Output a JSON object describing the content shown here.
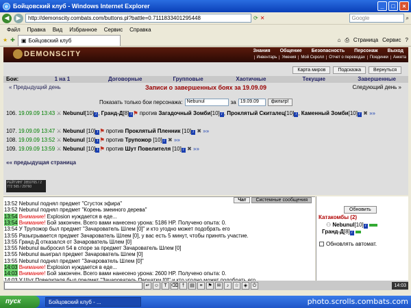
{
  "window": {
    "title": "Бойцовский клуб - Windows Internet Explorer"
  },
  "address": {
    "url": "http://demonscity.combats.com/buttons.pl?battle=0.7111833401295448",
    "search_placeholder": "Google"
  },
  "menu": [
    "Файл",
    "Правка",
    "Вид",
    "Избранное",
    "Сервис",
    "Справка"
  ],
  "tab": {
    "label": "Бойцовский клуб"
  },
  "ietools": {
    "page": "Страница",
    "service": "Сервис"
  },
  "game": {
    "logo": "DEMONSCITY",
    "topnav": [
      "Знания",
      "Общение",
      "Безопасность",
      "Персонаж",
      "Выход"
    ],
    "subnav": [
      "Инвентарь",
      "Умения",
      "Мой Скролл",
      "Отчет о переводах",
      "Поединки",
      "Анкета"
    ],
    "buttons": [
      "Карта миров",
      "Подсказка",
      "Вернуться"
    ],
    "fight_types": [
      "Бои:",
      "1 на 1",
      "Договорные",
      "Групповые",
      "Хаотичные",
      "Текущие",
      "Завершенные"
    ],
    "prev_day": "« Предыдущий день",
    "next_day": "Следующий день »",
    "records_title": "Записи о завершенных боях за 19.09.09",
    "filter": {
      "label": "Показать только бои персонажа:",
      "name": "Nebunul",
      "za": "за",
      "date": "19.09.09",
      "button": "фильтр!"
    },
    "prev_page": "«« предыдущая страница",
    "counter": "РЕЙТИНГ 2859765 / 2 772 565 / 29760"
  },
  "battles": [
    {
      "num": "106.",
      "date": "19.09.09",
      "time": "13:43",
      "p1": "Nebunul",
      "p1lvl": "[10]",
      "p2": "Гранд-Д",
      "p2lvl": "[8]",
      "vs": "против",
      "o1": "Загадочный Зомби",
      "o1lvl": "[10]",
      "o2": "Проклятый Скиталец",
      "o2lvl": "[10]",
      "o3": "Каменный Зомби",
      "o3lvl": "[10]",
      "more": "»»"
    },
    {
      "num": "107.",
      "date": "19.09.09",
      "time": "13:47",
      "p1": "Nebunul",
      "p1lvl": "[10]",
      "vs": "против",
      "o1": "Проклятый Пленник",
      "o1lvl": "[10]",
      "more": "»»"
    },
    {
      "num": "108.",
      "date": "19.09.09",
      "time": "13:52",
      "p1": "Nebunul",
      "p1lvl": "[10]",
      "vs": "против",
      "o1": "Трупожор",
      "o1lvl": "[10]",
      "more": "»»"
    },
    {
      "num": "109.",
      "date": "19.09.09",
      "time": "13:59",
      "p1": "Nebunul",
      "p1lvl": "[10]",
      "vs": "против",
      "o1": "Шут Повелителя",
      "o1lvl": "[10]",
      "more": "»»"
    }
  ],
  "chat": {
    "tabs": [
      "Чат",
      "Системные сообщения"
    ],
    "lines": [
      {
        "ts": "13:52",
        "hl": false,
        "text": "Nebunul поднял предмет \"Сгусток эфира\""
      },
      {
        "ts": "13:52",
        "hl": false,
        "text": "Nebunul поднял предмет \"Корень змеиного дерева\""
      },
      {
        "ts": "13:54",
        "hl": true,
        "warn": "Внимание!",
        "text": " Explosion нуждается в еде..."
      },
      {
        "ts": "13:54",
        "hl": true,
        "warn": "Внимание!",
        "text": " Бой закончен. Всего вами нанесено урона: 5186 HP. Получено опыта: 0."
      },
      {
        "ts": "13:54",
        "hl": false,
        "text": "У Трупожор был предмет \"Зачарователь Шлем [0]\" и кто угодно может подобрать его"
      },
      {
        "ts": "13:55",
        "hl": false,
        "text": "Разыгрывается предмет Зачарователь Шлем [0], у вас есть 5 минут, чтобы принять участие."
      },
      {
        "ts": "13:55",
        "hl": false,
        "text": "Гранд-Д отказался от Зачарователь Шлем [0]"
      },
      {
        "ts": "13:55",
        "hl": false,
        "text": "Nebunul выбросил 54 в споре за предмет Зачарователь Шлем [0]"
      },
      {
        "ts": "13:55",
        "hl": false,
        "text": "Nebunul выиграл предмет Зачарователь Шлем [0]"
      },
      {
        "ts": "13:55",
        "hl": false,
        "text": "Nebunul поднял предмет \"Зачарователь Шлем [0]\""
      },
      {
        "ts": "14:03",
        "hl": true,
        "warn": "Внимание!",
        "text": " Explosion нуждается в еде..."
      },
      {
        "ts": "14:03",
        "hl": true,
        "warn": "Внимание!",
        "text": " Бой закончен. Всего вами нанесено урона: 2600 HP. Получено опыта: 0."
      },
      {
        "ts": "14:03",
        "hl": false,
        "text": "У Шут Повелителя был предмет \"Зачарователь Перчатки [0]\" и кто угодно может подобрать его"
      }
    ]
  },
  "side": {
    "refresh": "Обновить",
    "location": "Катакомбы (2)",
    "members": [
      {
        "name": "Nebunul",
        "lvl": "[10]"
      },
      {
        "name": "Гранд-Д",
        "lvl": "[8]"
      }
    ],
    "auto_update": "Обновлять автомат."
  },
  "bottom": {
    "clock": "14:03"
  },
  "taskbar": {
    "start": "пуск",
    "task": "Бойцовский клуб - ...",
    "watermark": "photo.scrolls.combats.com"
  }
}
